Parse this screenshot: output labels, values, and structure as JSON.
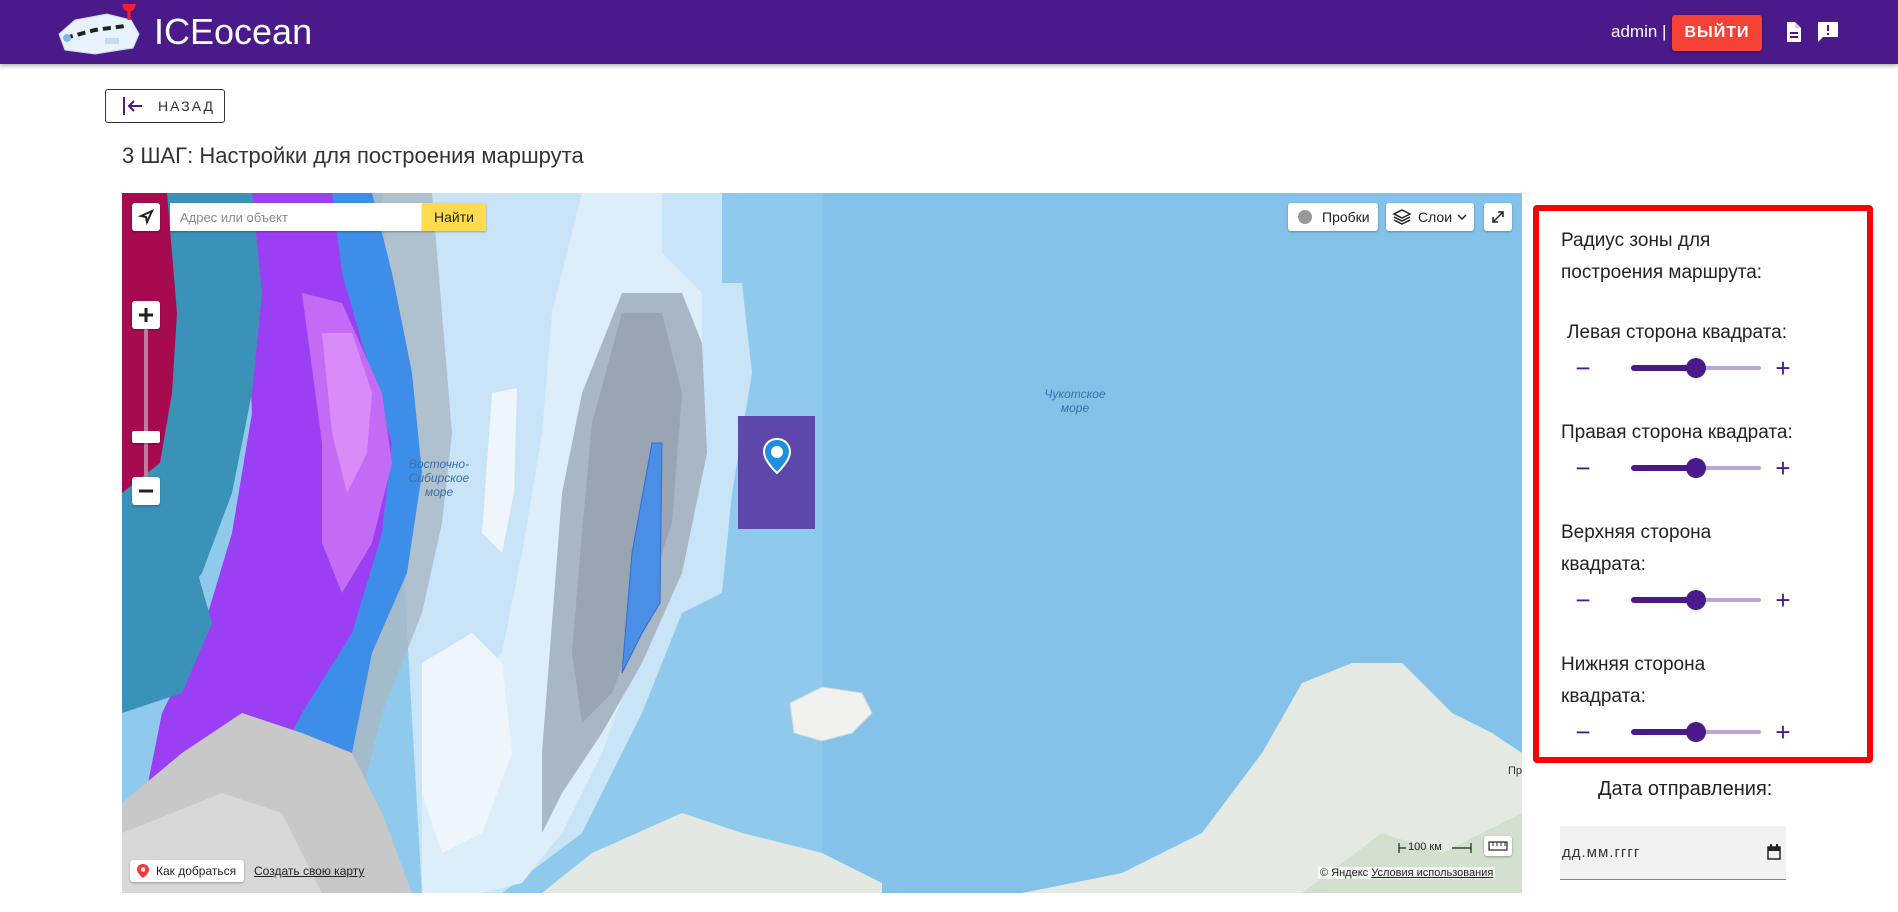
{
  "header": {
    "brand": "ICEocean",
    "user": "admin |",
    "logout_label": "ВЫЙТИ",
    "icons": [
      "document-icon",
      "feedback-icon"
    ],
    "color": "#4a1a8a"
  },
  "nav": {
    "back_label": "НАЗАД"
  },
  "step_title": "3 ШАГ: Настройки для построения маршрута",
  "map": {
    "search_placeholder": "Адрес или объект",
    "find_label": "Найти",
    "traffic_label": "Пробки",
    "layers_label": "Слои",
    "sea_labels": {
      "east_siberian_1": "Восточно-",
      "east_siberian_2": "Сибирское",
      "east_siberian_3": "море",
      "chukchi_1": "Чукотское",
      "chukchi_2": "море"
    },
    "route_label": "Как добраться",
    "create_map_label": "Создать свою карту",
    "scale_label": "100 км",
    "copyright": "© Яндекс",
    "terms_label": "Условия использования",
    "edge_fragment": "Пр"
  },
  "panel": {
    "title_line1": "Радиус зоны для",
    "title_line2": "построения маршрута:",
    "sliders": [
      {
        "label": "Левая сторона квадрата:",
        "value": 0.5
      },
      {
        "label": "Правая сторона квадрата:",
        "value": 0.5
      },
      {
        "label": "Верхняя сторона",
        "label2": "квадрата:",
        "value": 0.5
      },
      {
        "label": "Нижняя сторона",
        "label2": "квадрата:",
        "value": 0.5
      }
    ],
    "minus": "−",
    "plus": "+",
    "highlight_color": "#ff0000"
  },
  "date": {
    "label": "Дата отправления:",
    "placeholder": "дд.мм.гггг"
  }
}
